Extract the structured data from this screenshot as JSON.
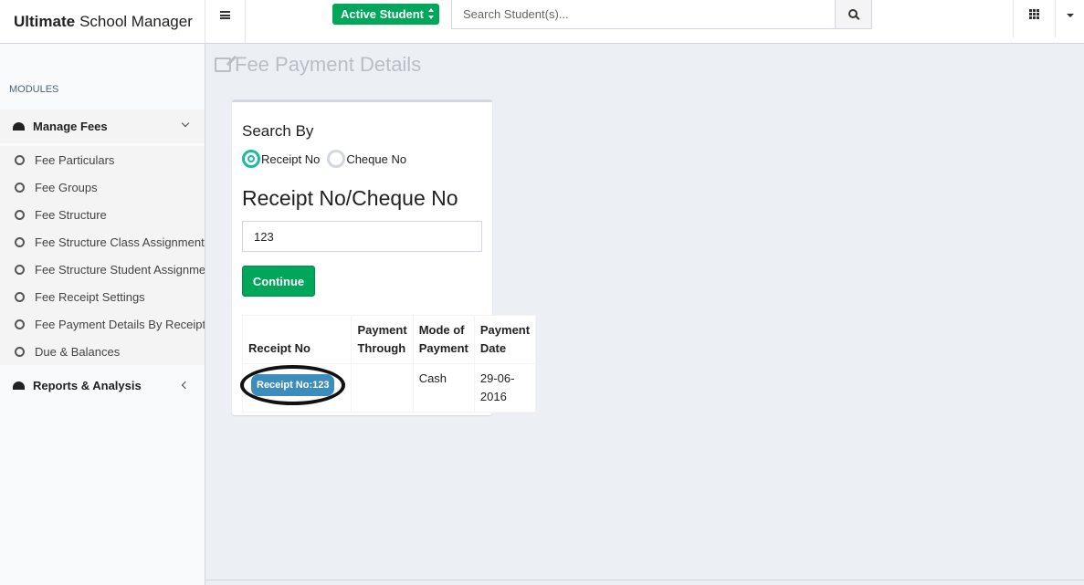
{
  "app": {
    "brand_bold": "Ultimate",
    "brand_rest": "School Manager"
  },
  "topbar": {
    "status_select": "Active Student",
    "search_placeholder": "Search Student(s)..."
  },
  "sidebar": {
    "section_header": "MODULES",
    "groups": [
      {
        "label": "Manage Fees",
        "expanded": true
      },
      {
        "label": "Reports & Analysis",
        "expanded": false
      }
    ],
    "items": [
      {
        "label": "Fee Particulars"
      },
      {
        "label": "Fee Groups"
      },
      {
        "label": "Fee Structure"
      },
      {
        "label": "Fee Structure Class Assignment"
      },
      {
        "label": "Fee Structure Student Assignment"
      },
      {
        "label": "Fee Receipt Settings"
      },
      {
        "label": "Fee Payment Details By Receipt No"
      },
      {
        "label": "Due & Balances"
      }
    ]
  },
  "main": {
    "title": "Fee Payment Details",
    "search_by": "Search By",
    "radio_options": [
      "Receipt No",
      "Cheque No"
    ],
    "selected_option": "Receipt No",
    "field_label": "Receipt No/Cheque No",
    "field_value": "123",
    "continue_label": "Continue",
    "table": {
      "headers": [
        "Receipt No",
        "Payment Through",
        "Mode of Payment",
        "Payment Date"
      ],
      "rows": [
        {
          "receipt": "Receipt No:123",
          "through": "",
          "mode": "Cash",
          "date": "29-06-2016"
        }
      ]
    }
  },
  "colors": {
    "primary_green": "#00a65a",
    "badge_blue": "#3c8dbc",
    "radio_accent": "#1abc9c"
  }
}
